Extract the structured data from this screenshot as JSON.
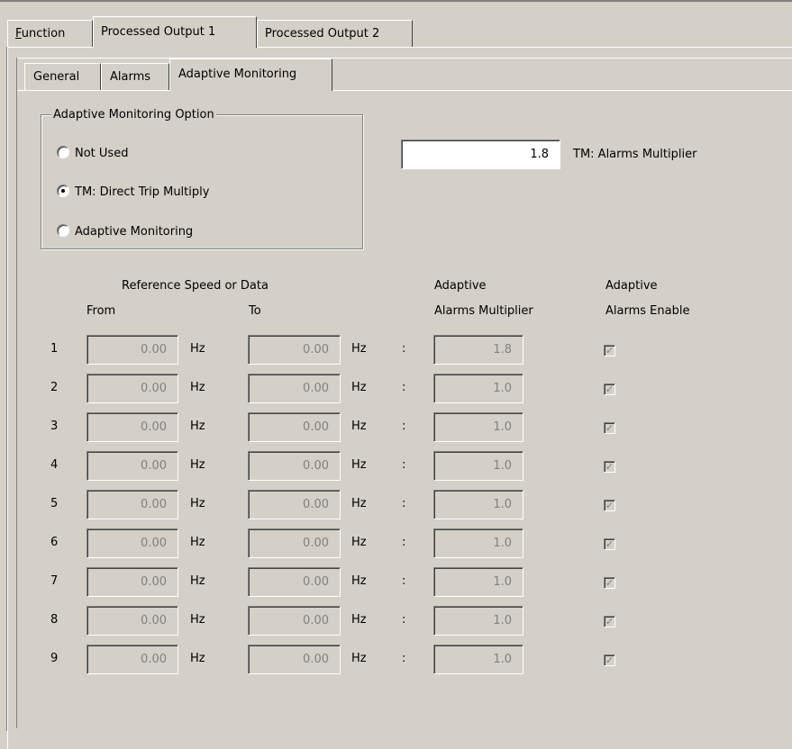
{
  "tabs": [
    {
      "label_prefix": "",
      "label_ul": "F",
      "label_rest": "unction"
    },
    {
      "label": "Processed Output 1"
    },
    {
      "label": "Processed Output 2"
    }
  ],
  "subtabs": [
    "General",
    "Alarms",
    "Adaptive Monitoring"
  ],
  "option_group": {
    "title": "Adaptive Monitoring Option",
    "options": [
      "Not Used",
      "TM: Direct Trip Multiply",
      "Adaptive Monitoring"
    ],
    "selected": "TM: Direct Trip Multiply"
  },
  "multiplier": {
    "value": "1.8",
    "label": "TM: Alarms Multiplier"
  },
  "headers": {
    "ref": "Reference Speed or Data",
    "from": "From",
    "to": "To",
    "am1": "Adaptive",
    "am2": "Alarms Multiplier",
    "ae1": "Adaptive",
    "ae2": "Alarms Enable"
  },
  "unit": "Hz",
  "colon": ":",
  "rows": [
    {
      "n": "1",
      "from": "0.00",
      "to": "0.00",
      "mult": "1.8",
      "enabled": true
    },
    {
      "n": "2",
      "from": "0.00",
      "to": "0.00",
      "mult": "1.0",
      "enabled": true
    },
    {
      "n": "3",
      "from": "0.00",
      "to": "0.00",
      "mult": "1.0",
      "enabled": true
    },
    {
      "n": "4",
      "from": "0.00",
      "to": "0.00",
      "mult": "1.0",
      "enabled": true
    },
    {
      "n": "5",
      "from": "0.00",
      "to": "0.00",
      "mult": "1.0",
      "enabled": true
    },
    {
      "n": "6",
      "from": "0.00",
      "to": "0.00",
      "mult": "1.0",
      "enabled": true
    },
    {
      "n": "7",
      "from": "0.00",
      "to": "0.00",
      "mult": "1.0",
      "enabled": true
    },
    {
      "n": "8",
      "from": "0.00",
      "to": "0.00",
      "mult": "1.0",
      "enabled": true
    },
    {
      "n": "9",
      "from": "0.00",
      "to": "0.00",
      "mult": "1.0",
      "enabled": true
    }
  ]
}
